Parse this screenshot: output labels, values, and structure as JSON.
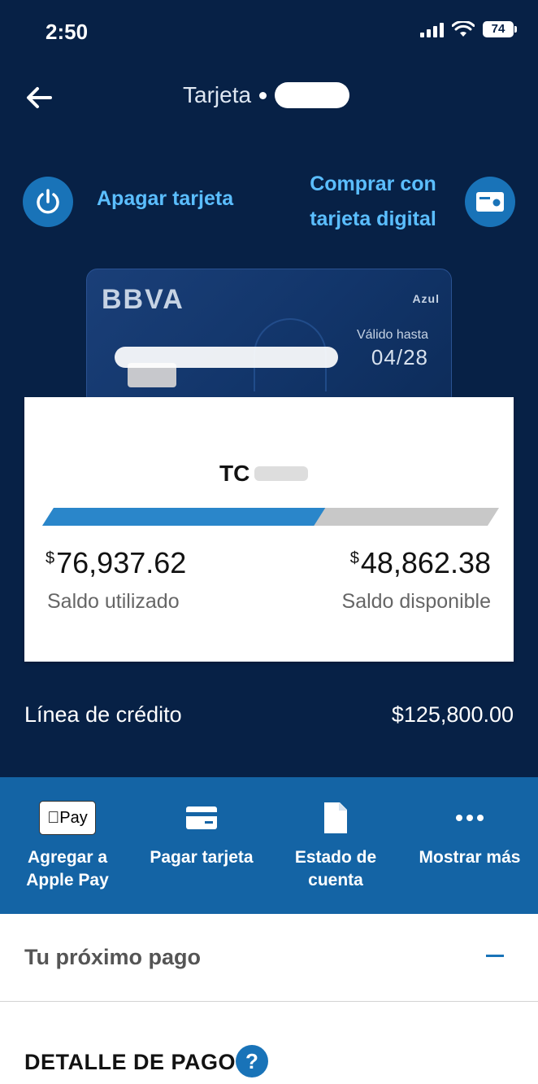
{
  "status_bar": {
    "time": "2:50",
    "battery": "74"
  },
  "header": {
    "title": "Tarjeta"
  },
  "actions": {
    "power_label": "Apagar tarjeta",
    "digital_label_line1": "Comprar con",
    "digital_label_line2": "tarjeta digital"
  },
  "card": {
    "brand": "BBVA",
    "type": "Azul",
    "valid_label": "Válido hasta",
    "expiry": "04/28"
  },
  "balance": {
    "card_name": "TC",
    "used_currency": "$",
    "used_amount": "76,937.62",
    "used_label": "Saldo utilizado",
    "available_currency": "$",
    "available_amount": "48,862.38",
    "available_label": "Saldo disponible",
    "used_fraction": 0.61
  },
  "credit_line": {
    "label": "Línea de crédito",
    "value": "$125,800.00"
  },
  "quick_actions": [
    {
      "icon": "apple-pay-icon",
      "icon_text": "Pay",
      "line1": "Agregar a",
      "line2": "Apple Pay"
    },
    {
      "icon": "card-payment-icon",
      "line1": "Pagar tarjeta",
      "line2": ""
    },
    {
      "icon": "document-icon",
      "line1": "Estado de",
      "line2": "cuenta"
    },
    {
      "icon": "more-icon",
      "line1": "Mostrar más",
      "line2": ""
    }
  ],
  "next_payment": {
    "label": "Tu próximo pago"
  },
  "payment_detail": {
    "label": "DETALLE DE PAGO",
    "help": "?"
  },
  "colors": {
    "header_bg": "#072146",
    "accent": "#1973b8",
    "link": "#5bbeff",
    "quick_bg": "#1464a5",
    "used_bar": "#2a86ca",
    "available_bar": "#c8c8c8"
  }
}
